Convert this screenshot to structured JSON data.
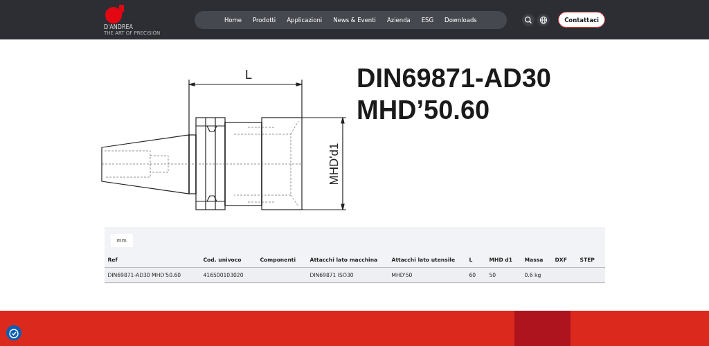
{
  "header": {
    "logo": {
      "name": "D'ANDREA",
      "tagline": "THE ART OF PRECISION"
    },
    "nav": [
      {
        "label": "Home"
      },
      {
        "label": "Prodotti"
      },
      {
        "label": "Applicazioni"
      },
      {
        "label": "News & Eventi"
      },
      {
        "label": "Azienda"
      },
      {
        "label": "ESG"
      },
      {
        "label": "Downloads"
      }
    ],
    "cta": "Contattaci"
  },
  "drawing": {
    "length_label": "L",
    "diameter_label": "MHD'd1"
  },
  "product": {
    "title_lines": [
      "DIN69871-AD30",
      "MHD’50.60"
    ]
  },
  "table": {
    "unit": "mm",
    "columns": [
      "Ref",
      "Cod. univoco",
      "Componenti",
      "Attacchi lato macchina",
      "Attacchi lato utensile",
      "L",
      "MHD d1",
      "Massa",
      "DXF",
      "STEP"
    ],
    "rows": [
      {
        "cells": [
          "DIN69871-AD30 MHD'50.60",
          "416500103020",
          null,
          "DIN69871 ISO30",
          "MHD'50",
          "60",
          "50",
          "0.6 kg",
          null,
          null
        ]
      }
    ]
  }
}
